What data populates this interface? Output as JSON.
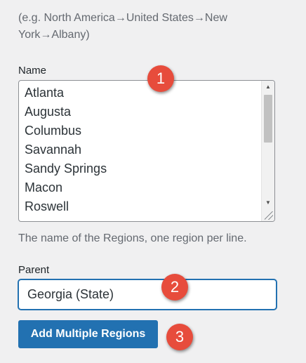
{
  "hint_text": "(e.g. North America→United States→New York→Albany)",
  "name_field": {
    "label": "Name",
    "lines": [
      "Atlanta",
      "Augusta",
      "Columbus",
      "Savannah",
      "Sandy Springs",
      "Macon",
      "Roswell"
    ],
    "description": "The name of the Regions, one region per line."
  },
  "parent_field": {
    "label": "Parent",
    "value": "Georgia (State)"
  },
  "submit_button": {
    "label": "Add Multiple Regions"
  },
  "annotations": [
    "1",
    "2",
    "3"
  ],
  "colors": {
    "background": "#f0f0f1",
    "accent": "#2271b1",
    "badge": "#e74c3c"
  }
}
